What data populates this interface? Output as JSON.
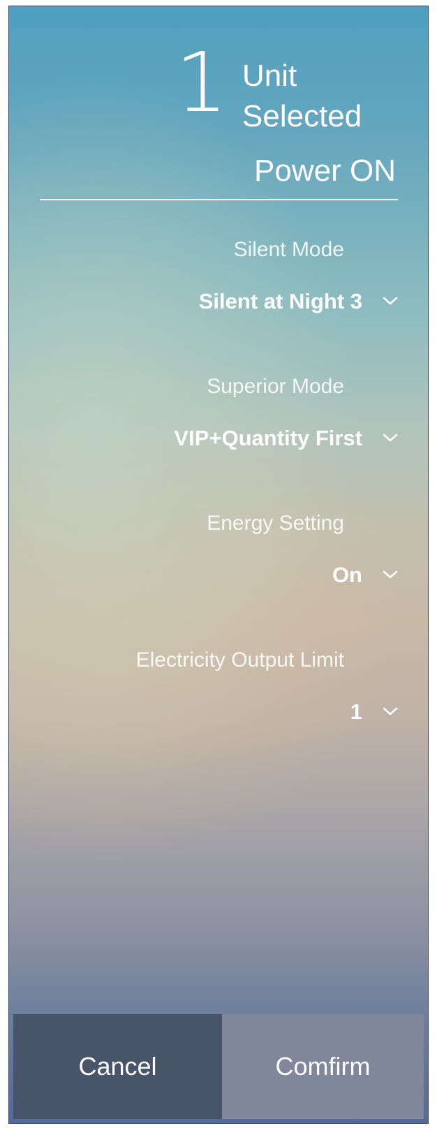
{
  "header": {
    "count": "1",
    "count_unit": "Unit",
    "count_suffix": "Selected",
    "power_status": "Power ON"
  },
  "settings": [
    {
      "label": "Silent Mode",
      "value": "Silent at Night 3",
      "icon": "chevron-down-icon"
    },
    {
      "label": "Superior Mode",
      "value": "VIP+Quantity First",
      "icon": "chevron-down-icon"
    },
    {
      "label": "Energy Setting",
      "value": "On",
      "icon": "chevron-down-icon"
    },
    {
      "label": "Electricity Output Limit",
      "value": "1",
      "icon": "chevron-down-icon"
    }
  ],
  "footer": {
    "cancel_label": "Cancel",
    "confirm_label": "Comfirm"
  },
  "colors": {
    "cancel_bg": "#475469",
    "confirm_bg": "#80879a",
    "text": "#ffffff"
  }
}
